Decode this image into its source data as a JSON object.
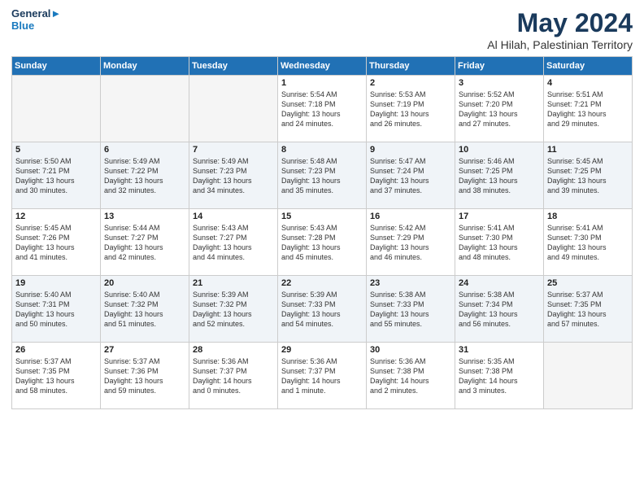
{
  "logo": {
    "line1": "General",
    "line2": "Blue"
  },
  "title": "May 2024",
  "subtitle": "Al Hilah, Palestinian Territory",
  "days_of_week": [
    "Sunday",
    "Monday",
    "Tuesday",
    "Wednesday",
    "Thursday",
    "Friday",
    "Saturday"
  ],
  "weeks": [
    [
      {
        "day": "",
        "empty": true
      },
      {
        "day": "",
        "empty": true
      },
      {
        "day": "",
        "empty": true
      },
      {
        "day": "1",
        "line1": "Sunrise: 5:54 AM",
        "line2": "Sunset: 7:18 PM",
        "line3": "Daylight: 13 hours",
        "line4": "and 24 minutes."
      },
      {
        "day": "2",
        "line1": "Sunrise: 5:53 AM",
        "line2": "Sunset: 7:19 PM",
        "line3": "Daylight: 13 hours",
        "line4": "and 26 minutes."
      },
      {
        "day": "3",
        "line1": "Sunrise: 5:52 AM",
        "line2": "Sunset: 7:20 PM",
        "line3": "Daylight: 13 hours",
        "line4": "and 27 minutes."
      },
      {
        "day": "4",
        "line1": "Sunrise: 5:51 AM",
        "line2": "Sunset: 7:21 PM",
        "line3": "Daylight: 13 hours",
        "line4": "and 29 minutes."
      }
    ],
    [
      {
        "day": "5",
        "line1": "Sunrise: 5:50 AM",
        "line2": "Sunset: 7:21 PM",
        "line3": "Daylight: 13 hours",
        "line4": "and 30 minutes."
      },
      {
        "day": "6",
        "line1": "Sunrise: 5:49 AM",
        "line2": "Sunset: 7:22 PM",
        "line3": "Daylight: 13 hours",
        "line4": "and 32 minutes."
      },
      {
        "day": "7",
        "line1": "Sunrise: 5:49 AM",
        "line2": "Sunset: 7:23 PM",
        "line3": "Daylight: 13 hours",
        "line4": "and 34 minutes."
      },
      {
        "day": "8",
        "line1": "Sunrise: 5:48 AM",
        "line2": "Sunset: 7:23 PM",
        "line3": "Daylight: 13 hours",
        "line4": "and 35 minutes."
      },
      {
        "day": "9",
        "line1": "Sunrise: 5:47 AM",
        "line2": "Sunset: 7:24 PM",
        "line3": "Daylight: 13 hours",
        "line4": "and 37 minutes."
      },
      {
        "day": "10",
        "line1": "Sunrise: 5:46 AM",
        "line2": "Sunset: 7:25 PM",
        "line3": "Daylight: 13 hours",
        "line4": "and 38 minutes."
      },
      {
        "day": "11",
        "line1": "Sunrise: 5:45 AM",
        "line2": "Sunset: 7:25 PM",
        "line3": "Daylight: 13 hours",
        "line4": "and 39 minutes."
      }
    ],
    [
      {
        "day": "12",
        "line1": "Sunrise: 5:45 AM",
        "line2": "Sunset: 7:26 PM",
        "line3": "Daylight: 13 hours",
        "line4": "and 41 minutes."
      },
      {
        "day": "13",
        "line1": "Sunrise: 5:44 AM",
        "line2": "Sunset: 7:27 PM",
        "line3": "Daylight: 13 hours",
        "line4": "and 42 minutes."
      },
      {
        "day": "14",
        "line1": "Sunrise: 5:43 AM",
        "line2": "Sunset: 7:27 PM",
        "line3": "Daylight: 13 hours",
        "line4": "and 44 minutes."
      },
      {
        "day": "15",
        "line1": "Sunrise: 5:43 AM",
        "line2": "Sunset: 7:28 PM",
        "line3": "Daylight: 13 hours",
        "line4": "and 45 minutes."
      },
      {
        "day": "16",
        "line1": "Sunrise: 5:42 AM",
        "line2": "Sunset: 7:29 PM",
        "line3": "Daylight: 13 hours",
        "line4": "and 46 minutes."
      },
      {
        "day": "17",
        "line1": "Sunrise: 5:41 AM",
        "line2": "Sunset: 7:30 PM",
        "line3": "Daylight: 13 hours",
        "line4": "and 48 minutes."
      },
      {
        "day": "18",
        "line1": "Sunrise: 5:41 AM",
        "line2": "Sunset: 7:30 PM",
        "line3": "Daylight: 13 hours",
        "line4": "and 49 minutes."
      }
    ],
    [
      {
        "day": "19",
        "line1": "Sunrise: 5:40 AM",
        "line2": "Sunset: 7:31 PM",
        "line3": "Daylight: 13 hours",
        "line4": "and 50 minutes."
      },
      {
        "day": "20",
        "line1": "Sunrise: 5:40 AM",
        "line2": "Sunset: 7:32 PM",
        "line3": "Daylight: 13 hours",
        "line4": "and 51 minutes."
      },
      {
        "day": "21",
        "line1": "Sunrise: 5:39 AM",
        "line2": "Sunset: 7:32 PM",
        "line3": "Daylight: 13 hours",
        "line4": "and 52 minutes."
      },
      {
        "day": "22",
        "line1": "Sunrise: 5:39 AM",
        "line2": "Sunset: 7:33 PM",
        "line3": "Daylight: 13 hours",
        "line4": "and 54 minutes."
      },
      {
        "day": "23",
        "line1": "Sunrise: 5:38 AM",
        "line2": "Sunset: 7:33 PM",
        "line3": "Daylight: 13 hours",
        "line4": "and 55 minutes."
      },
      {
        "day": "24",
        "line1": "Sunrise: 5:38 AM",
        "line2": "Sunset: 7:34 PM",
        "line3": "Daylight: 13 hours",
        "line4": "and 56 minutes."
      },
      {
        "day": "25",
        "line1": "Sunrise: 5:37 AM",
        "line2": "Sunset: 7:35 PM",
        "line3": "Daylight: 13 hours",
        "line4": "and 57 minutes."
      }
    ],
    [
      {
        "day": "26",
        "line1": "Sunrise: 5:37 AM",
        "line2": "Sunset: 7:35 PM",
        "line3": "Daylight: 13 hours",
        "line4": "and 58 minutes."
      },
      {
        "day": "27",
        "line1": "Sunrise: 5:37 AM",
        "line2": "Sunset: 7:36 PM",
        "line3": "Daylight: 13 hours",
        "line4": "and 59 minutes."
      },
      {
        "day": "28",
        "line1": "Sunrise: 5:36 AM",
        "line2": "Sunset: 7:37 PM",
        "line3": "Daylight: 14 hours",
        "line4": "and 0 minutes."
      },
      {
        "day": "29",
        "line1": "Sunrise: 5:36 AM",
        "line2": "Sunset: 7:37 PM",
        "line3": "Daylight: 14 hours",
        "line4": "and 1 minute."
      },
      {
        "day": "30",
        "line1": "Sunrise: 5:36 AM",
        "line2": "Sunset: 7:38 PM",
        "line3": "Daylight: 14 hours",
        "line4": "and 2 minutes."
      },
      {
        "day": "31",
        "line1": "Sunrise: 5:35 AM",
        "line2": "Sunset: 7:38 PM",
        "line3": "Daylight: 14 hours",
        "line4": "and 3 minutes."
      },
      {
        "day": "",
        "empty": true
      }
    ]
  ]
}
